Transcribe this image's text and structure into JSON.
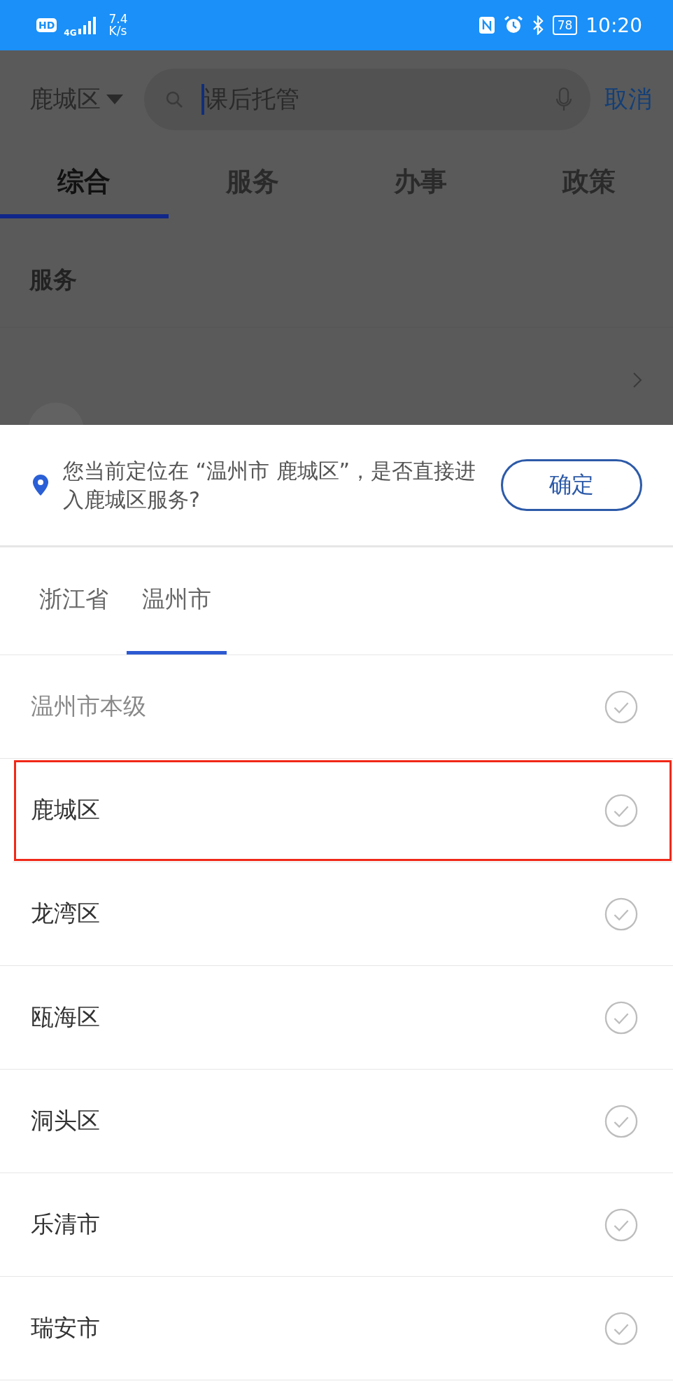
{
  "status_bar": {
    "hd": "HD",
    "network_type": "4G",
    "network_speed": "7.4",
    "network_unit": "K/s",
    "battery": "78",
    "time": "10:20"
  },
  "header": {
    "region": "鹿城区",
    "search": {
      "value": "课后托管"
    },
    "cancel": "取消"
  },
  "result_tabs": [
    {
      "label": "综合",
      "selected": true
    },
    {
      "label": "服务",
      "selected": false
    },
    {
      "label": "办事",
      "selected": false
    },
    {
      "label": "政策",
      "selected": false
    }
  ],
  "section_title": "服务",
  "location_prompt": {
    "text": "您当前定位在 “温州市 鹿城区”，是否直接进入鹿城区服务?",
    "confirm": "确定"
  },
  "level_tabs": [
    {
      "label": "浙江省",
      "selected": false
    },
    {
      "label": "温州市",
      "selected": true
    }
  ],
  "districts": [
    {
      "name": "温州市本级",
      "disabled": true,
      "highlighted": false
    },
    {
      "name": "鹿城区",
      "disabled": false,
      "highlighted": true
    },
    {
      "name": "龙湾区",
      "disabled": false,
      "highlighted": false
    },
    {
      "name": "瓯海区",
      "disabled": false,
      "highlighted": false
    },
    {
      "name": "洞头区",
      "disabled": false,
      "highlighted": false
    },
    {
      "name": "乐清市",
      "disabled": false,
      "highlighted": false
    },
    {
      "name": "瑞安市",
      "disabled": false,
      "highlighted": false
    }
  ]
}
